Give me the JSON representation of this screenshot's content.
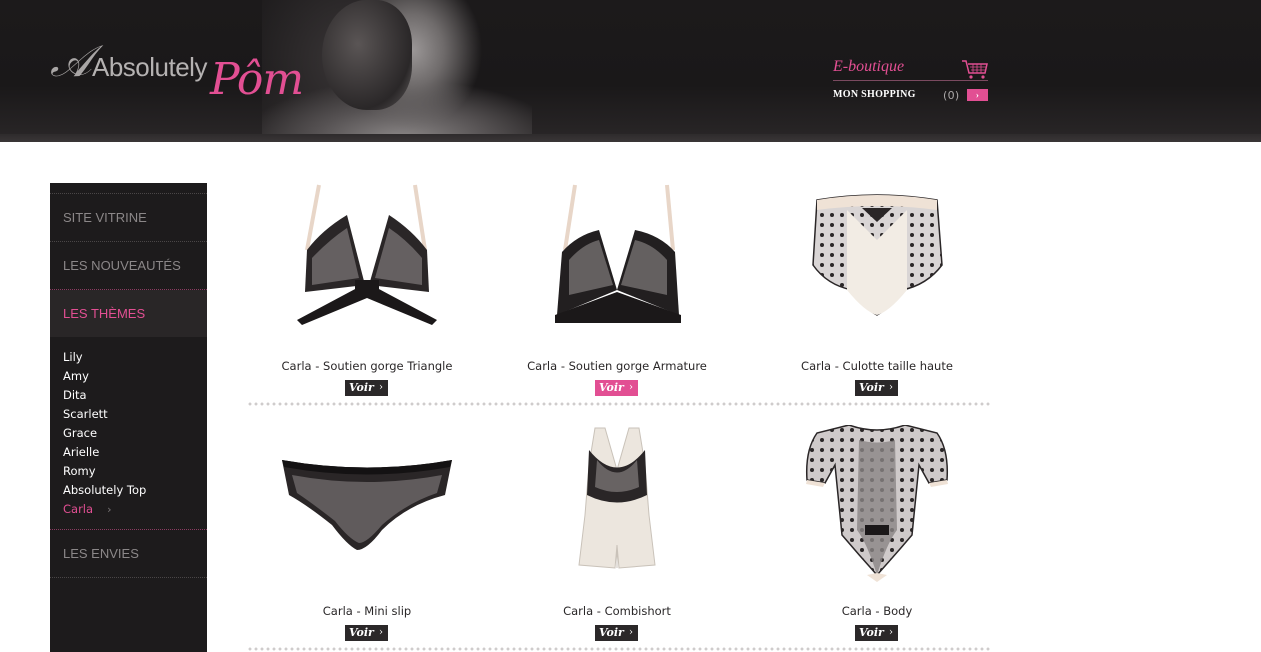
{
  "brand": {
    "logo_word1": "Absolutely",
    "logo_word2": "Pôm",
    "accent_color": "#e24f93"
  },
  "header": {
    "eboutique_label": "E-boutique",
    "shopping_label": "MON SHOPPING",
    "cart_count": "(0)",
    "cart_icon": "shopping-cart-icon",
    "go_arrow": "›"
  },
  "sidebar": {
    "items": [
      {
        "label": "SITE VITRINE"
      },
      {
        "label": "LES NOUVEAUTÉS"
      },
      {
        "label": "LES THÈMES"
      },
      {
        "label": "LES ENVIES"
      }
    ],
    "themes": [
      {
        "label": "Lily"
      },
      {
        "label": "Amy"
      },
      {
        "label": "Dita"
      },
      {
        "label": "Scarlett"
      },
      {
        "label": "Grace"
      },
      {
        "label": "Arielle"
      },
      {
        "label": "Romy"
      },
      {
        "label": "Absolutely Top"
      },
      {
        "label": "Carla"
      }
    ],
    "chevron": "›"
  },
  "products": [
    {
      "name": "Carla - Soutien gorge Triangle",
      "button": "Voir"
    },
    {
      "name": "Carla - Soutien gorge Armature",
      "button": "Voir"
    },
    {
      "name": "Carla - Culotte taille haute",
      "button": "Voir"
    },
    {
      "name": "Carla - Mini slip",
      "button": "Voir"
    },
    {
      "name": "Carla - Combishort",
      "button": "Voir"
    },
    {
      "name": "Carla - Body",
      "button": "Voir"
    }
  ],
  "button_arrow": "›"
}
